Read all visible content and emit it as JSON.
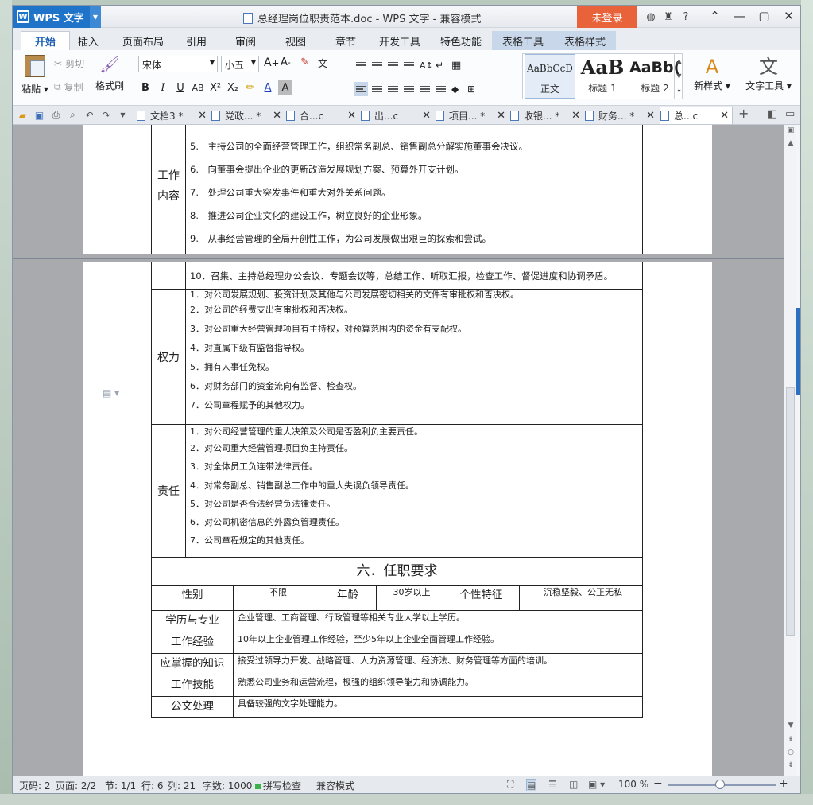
{
  "app": {
    "name": "WPS 文字",
    "window_title": "总经理岗位职责范本.doc - WPS 文字 - 兼容模式",
    "login_label": "未登录"
  },
  "ribbon_tabs": [
    "开始",
    "插入",
    "页面布局",
    "引用",
    "审阅",
    "视图",
    "章节",
    "开发工具",
    "特色功能",
    "表格工具",
    "表格样式"
  ],
  "ribbon": {
    "paste": "粘贴",
    "cut": "剪切",
    "copy": "复制",
    "format_painter": "格式刷",
    "font_name": "宋体",
    "font_size": "小五",
    "styles": [
      {
        "preview": "AaBbCcD",
        "label": "正文"
      },
      {
        "preview": "AaB",
        "label": "标题 1"
      },
      {
        "preview": "AaBb(",
        "label": "标题 2"
      }
    ],
    "new_style": "新样式",
    "text_tools": "文字工具"
  },
  "doc_tabs": [
    {
      "label": "文档3 *"
    },
    {
      "label": "党政... *"
    },
    {
      "label": "合...c"
    },
    {
      "label": "出...c"
    },
    {
      "label": "项目... *"
    },
    {
      "label": "收银... *"
    },
    {
      "label": "财务... *"
    },
    {
      "label": "总...c"
    }
  ],
  "document": {
    "work_label": "工作\n内容",
    "work_items": [
      "5.　主持公司的全面经营管理工作，组织常务副总、销售副总分解实施董事会决议。",
      "6.　向董事会提出企业的更新改造发展规划方案、预算外开支计划。",
      "7.　处理公司重大突发事件和重大对外关系问题。",
      "8.　推进公司企业文化的建设工作，树立良好的企业形象。",
      "9.　从事经营管理的全局开创性工作，为公司发展做出艰巨的探索和尝试。"
    ],
    "work_item_10": "10．召集、主持总经理办公会议、专题会议等，总结工作、听取汇报，检查工作、督促进度和协调矛盾。",
    "power_label": "权力",
    "power_items": [
      "1．对公司发展规划、投资计划及其他与公司发展密切相关的文件有审批权和否决权。",
      "2．对公司的经费支出有审批权和否决权。",
      "3．对公司重大经营管理项目有主持权，对预算范围内的资金有支配权。",
      "4．对直属下级有监督指导权。",
      "5．拥有人事任免权。",
      "6．对财务部门的资金流向有监督、检查权。",
      "7．公司章程赋予的其他权力。"
    ],
    "duty_label": "责任",
    "duty_items": [
      "1．对公司经营管理的重大决策及公司是否盈利负主要责任。",
      "2．对公司重大经营管理项目负主持责任。",
      "3．对全体员工负连带法律责任。",
      "4．对常务副总、销售副总工作中的重大失误负领导责任。",
      "5．对公司是否合法经营负法律责任。",
      "6．对公司机密信息的外露负管理责任。",
      "7．公司章程规定的其他责任。"
    ],
    "section_title": "六．任职要求",
    "req": {
      "gender_label": "性别",
      "gender_value": "不限",
      "age_label": "年龄",
      "age_value": "30岁以上",
      "personality_label": "个性特征",
      "personality_value": "沉稳坚毅、公正无私",
      "rows": [
        {
          "label": "学历与专业",
          "value": "企业管理、工商管理、行政管理等相关专业大学以上学历。"
        },
        {
          "label": "工作经验",
          "value": "10年以上企业管理工作经验，至少5年以上企业全面管理工作经验。"
        },
        {
          "label": "应掌握的知识",
          "value": "接受过领导力开发、战略管理、人力资源管理、经济法、财务管理等方面的培训。"
        },
        {
          "label": "工作技能",
          "value": "熟悉公司业务和运营流程，极强的组织领导能力和协调能力。"
        },
        {
          "label": "公文处理",
          "value": "具备较强的文字处理能力。"
        }
      ]
    }
  },
  "status": {
    "page": "页码: 2",
    "pages": "页面: 2/2",
    "section": "节: 1/1",
    "row": "行: 6",
    "col": "列: 21",
    "words": "字数: 1000",
    "spell": "拼写检查",
    "compat": "兼容模式",
    "zoom": "100 %"
  },
  "colors": {
    "accent": "#1f73c8",
    "login": "#e8623a"
  }
}
